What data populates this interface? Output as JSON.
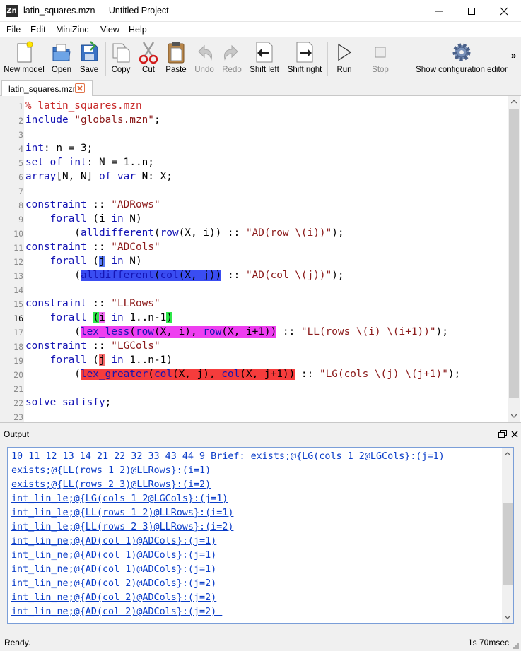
{
  "window": {
    "title": "latin_squares.mzn — Untitled Project",
    "app_icon_text": "Zn"
  },
  "menu": [
    "File",
    "Edit",
    "MiniZinc",
    "View",
    "Help"
  ],
  "toolbar": {
    "new_model": "New model",
    "open": "Open",
    "save": "Save",
    "copy": "Copy",
    "cut": "Cut",
    "paste": "Paste",
    "undo": "Undo",
    "redo": "Redo",
    "shift_left": "Shift left",
    "shift_right": "Shift right",
    "run": "Run",
    "stop": "Stop",
    "config": "Show configuration editor",
    "more": "»"
  },
  "tab": {
    "label": "latin_squares.mzn"
  },
  "editor": {
    "current_line": 16,
    "line_numbers": [
      "1",
      "2",
      "3",
      "4",
      "5",
      "6",
      "7",
      "8",
      "9",
      "10",
      "11",
      "12",
      "13",
      "14",
      "15",
      "16",
      "17",
      "18",
      "19",
      "20",
      "21",
      "22",
      "23"
    ]
  },
  "output": {
    "title": "Output",
    "lines": [
      "10 11 12 13 14 21 22 32 33 43 44 9 Brief: exists;@{LG(cols 1 2@LGCols}:(j=1)",
      "exists;@{LL(rows 1 2)@LLRows}:(i=1)",
      "exists;@{LL(rows 2 3)@LLRows}:(i=2)",
      "int_lin_le;@{LG(cols 1 2@LGCols}:(j=1)",
      "int_lin_le;@{LL(rows 1 2)@LLRows}:(i=1)",
      "int_lin_le;@{LL(rows 2 3)@LLRows}:(i=2)",
      "int_lin_ne;@{AD(col 1)@ADCols}:(j=1)",
      "int_lin_ne;@{AD(col 1)@ADCols}:(j=1)",
      "int_lin_ne;@{AD(col 1)@ADCols}:(j=1)",
      "int_lin_ne;@{AD(col 2)@ADCols}:(j=2)",
      "int_lin_ne;@{AD(col 2)@ADCols}:(j=2)",
      "int_lin_ne;@{AD(col 2)@ADCols}:(j=2) "
    ]
  },
  "status": {
    "text": "Ready.",
    "time": "1s 70msec"
  },
  "colors": {
    "keyword": "#1414b4",
    "string": "#8b1a1a",
    "comment": "#c82828",
    "link": "#0a3cc8",
    "hl_blue": "#3a4df2",
    "hl_green": "#2ee84a",
    "hl_magenta": "#ee3ff0",
    "hl_red": "#f53c3c"
  }
}
